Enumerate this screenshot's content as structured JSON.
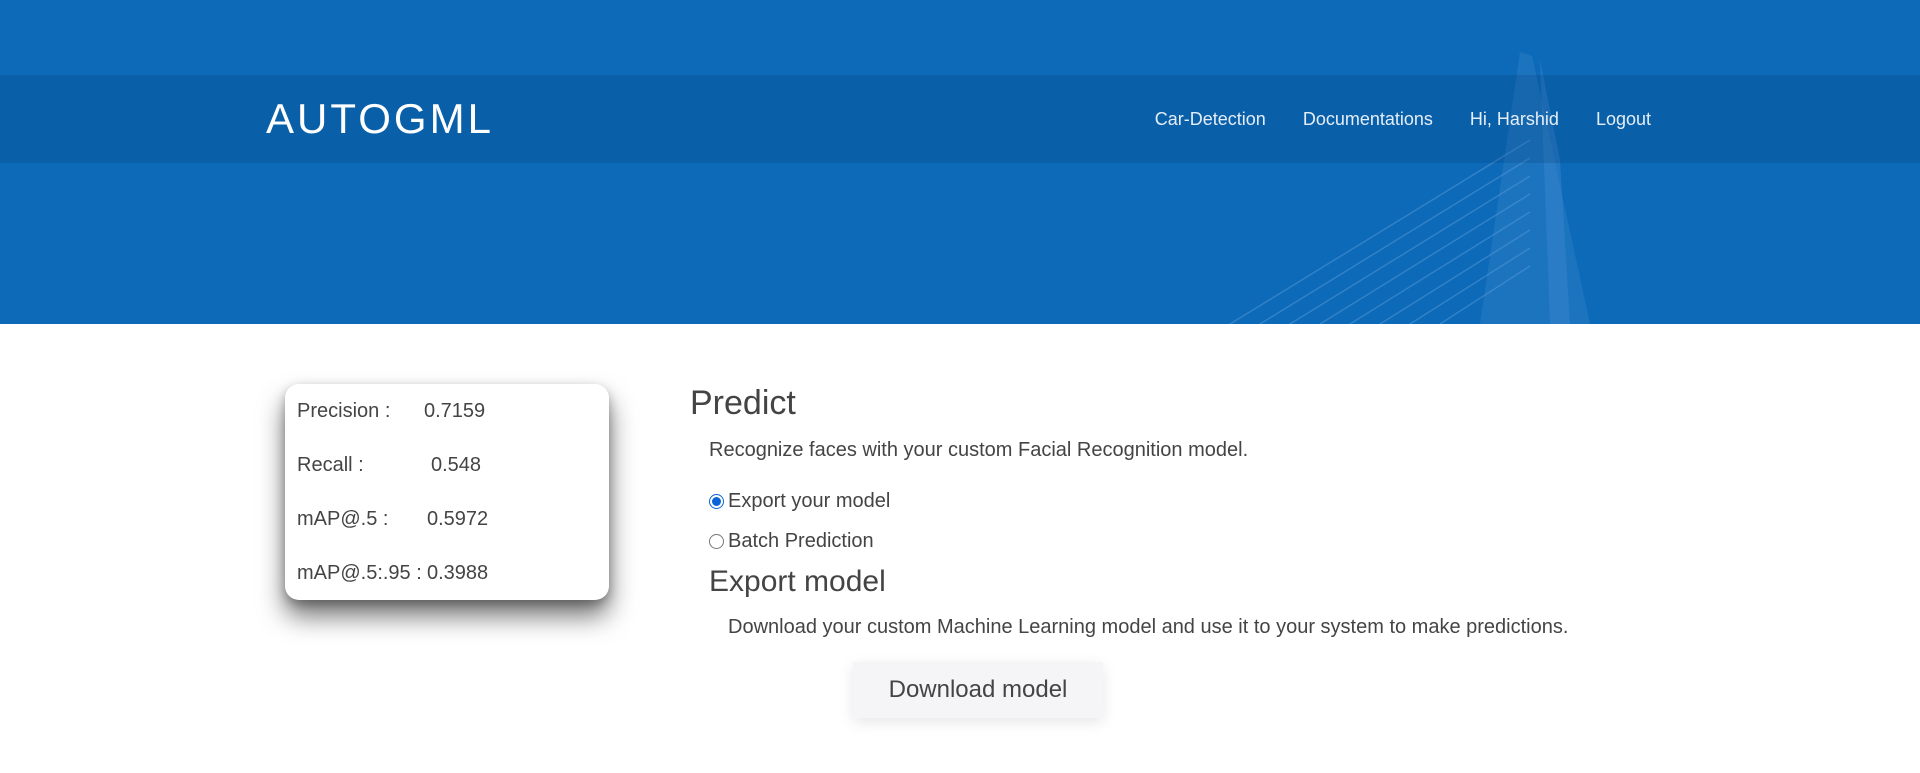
{
  "header": {
    "brand": "AUTOGML",
    "nav": [
      {
        "label": "Car-Detection"
      },
      {
        "label": "Documentations"
      },
      {
        "label": "Hi, Harshid"
      },
      {
        "label": "Logout"
      }
    ],
    "colors": {
      "hero_bg": "#0d6ab9"
    }
  },
  "metrics": [
    {
      "label": "Precision :",
      "value": "0.7159"
    },
    {
      "label": "Recall :",
      "value": "0.548"
    },
    {
      "label": "mAP@.5 :",
      "value": "0.5972"
    },
    {
      "label": "mAP@.5:.95 :",
      "value": "0.3988"
    }
  ],
  "predict": {
    "title": "Predict",
    "description": "Recognize faces with your custom Facial Recognition model.",
    "options": [
      {
        "label": "Export your model",
        "checked": true
      },
      {
        "label": "Batch Prediction",
        "checked": false
      }
    ]
  },
  "export": {
    "title": "Export model",
    "description": "Download your custom Machine Learning model and use it to your system to make predictions.",
    "button_label": "Download model"
  }
}
